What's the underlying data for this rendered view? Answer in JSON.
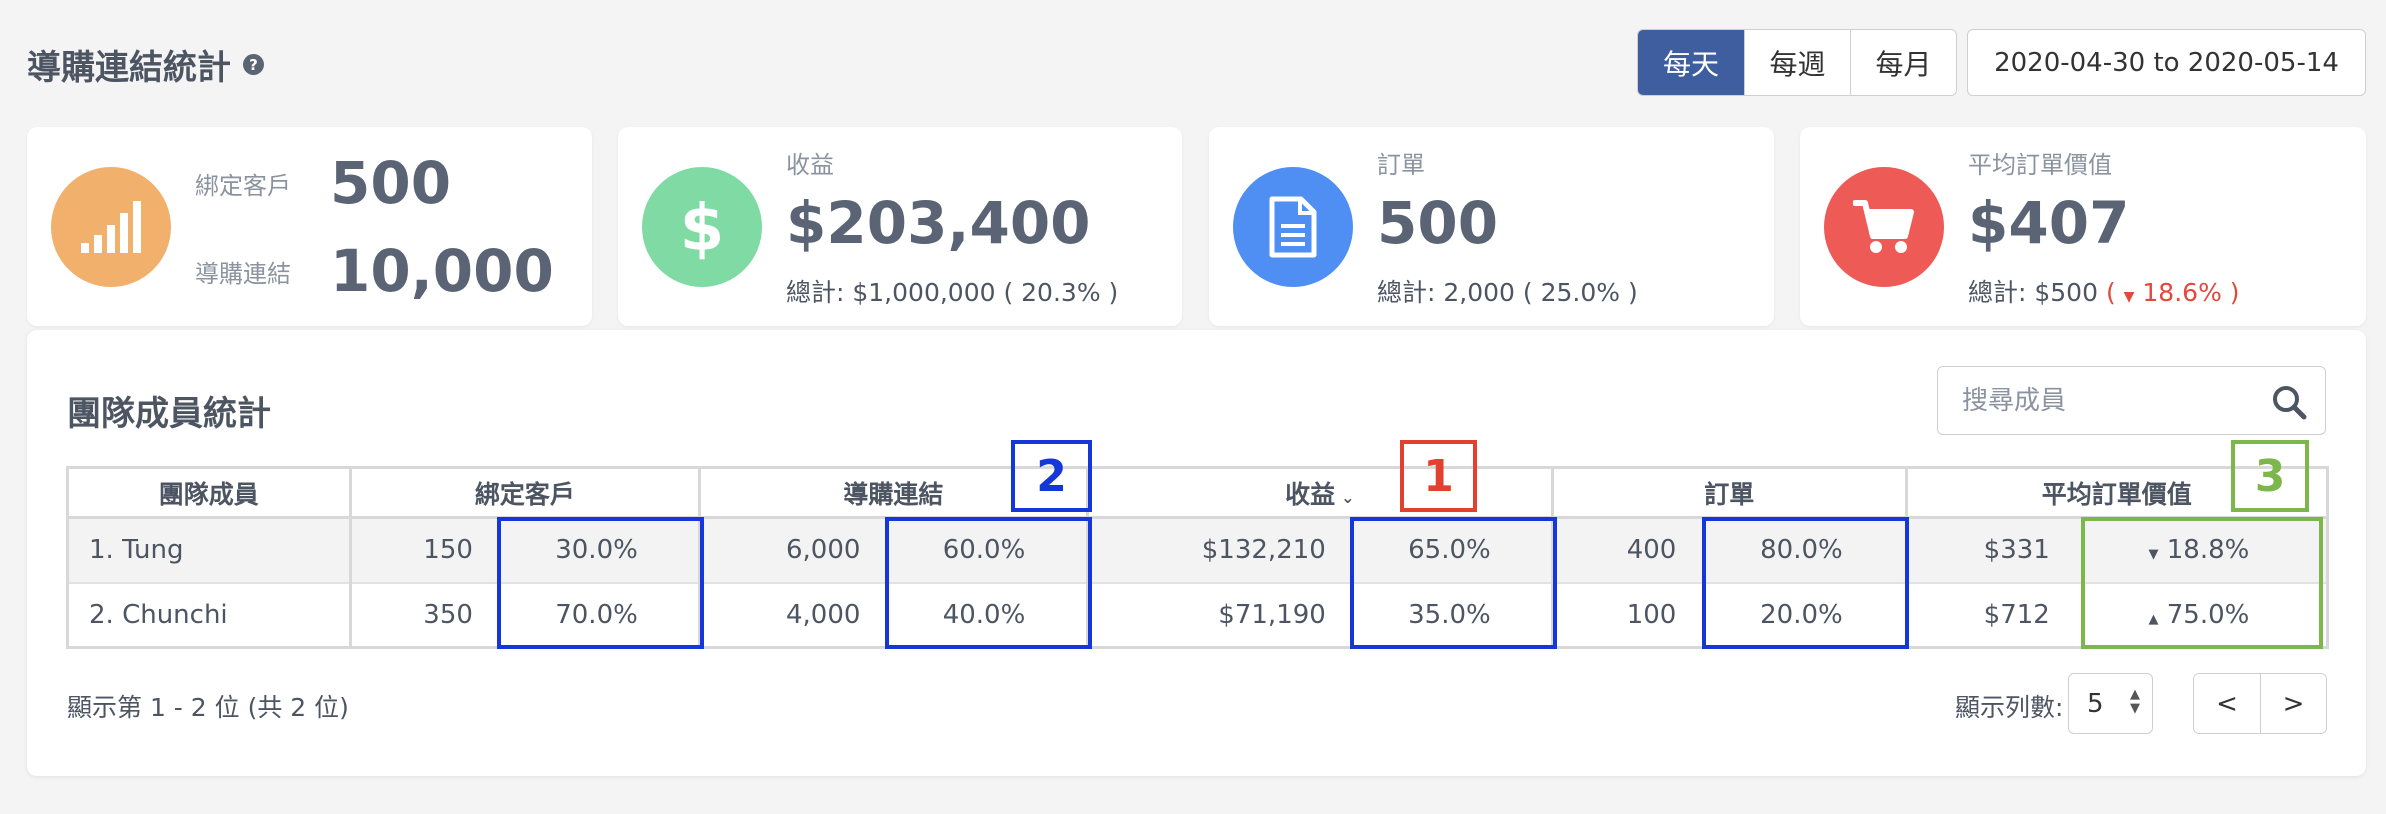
{
  "header": {
    "title": "導購連結統計",
    "help": "?"
  },
  "period": {
    "options": [
      "每天",
      "每週",
      "每月"
    ],
    "active": "每天"
  },
  "date_range": "2020-04-30 to 2020-05-14",
  "cards": {
    "customers": {
      "label": "綁定客戶",
      "value": "500",
      "links_label": "導購連結",
      "links_value": "10,000",
      "color": "#f2b06d",
      "icon": "signal-bars-icon"
    },
    "revenue": {
      "label": "收益",
      "value": "$203,400",
      "total": "總計: $1,000,000 ( 20.3% )",
      "color": "#7fdba3",
      "icon": "dollar-icon"
    },
    "orders": {
      "label": "訂單",
      "value": "500",
      "total": "總計: 2,000 ( 25.0% )",
      "color": "#4f8ef2",
      "icon": "document-icon"
    },
    "avg_order": {
      "label": "平均訂單價值",
      "value": "$407",
      "total_prefix": "總計: $500",
      "total_change_open": "(",
      "total_change": "18.6%",
      "total_change_close": ")",
      "color": "#ee5a55",
      "icon": "cart-icon"
    }
  },
  "team": {
    "title": "團隊成員統計",
    "search_placeholder": "搜尋成員",
    "columns": [
      "團隊成員",
      "綁定客戶",
      "導購連結",
      "收益",
      "訂單",
      "平均訂單價值"
    ],
    "rows": [
      {
        "name": "1. Tung",
        "customers": "150",
        "customers_pct": "30.0%",
        "links": "6,000",
        "links_pct": "60.0%",
        "revenue": "$132,210",
        "revenue_pct": "65.0%",
        "orders": "400",
        "orders_pct": "80.0%",
        "avg": "$331",
        "avg_trend": "18.8%",
        "avg_dir": "down"
      },
      {
        "name": "2. Chunchi",
        "customers": "350",
        "customers_pct": "70.0%",
        "links": "4,000",
        "links_pct": "40.0%",
        "revenue": "$71,190",
        "revenue_pct": "35.0%",
        "orders": "100",
        "orders_pct": "20.0%",
        "avg": "$712",
        "avg_trend": "75.0%",
        "avg_dir": "up"
      }
    ],
    "pagination_info": "顯示第 1 - 2 位 (共 2 位)",
    "rows_per_page_label": "顯示列數:",
    "rows_per_page": "5",
    "prev": "<",
    "next": ">"
  },
  "annotations": {
    "label1": "1",
    "label2": "2",
    "label3": "3"
  }
}
